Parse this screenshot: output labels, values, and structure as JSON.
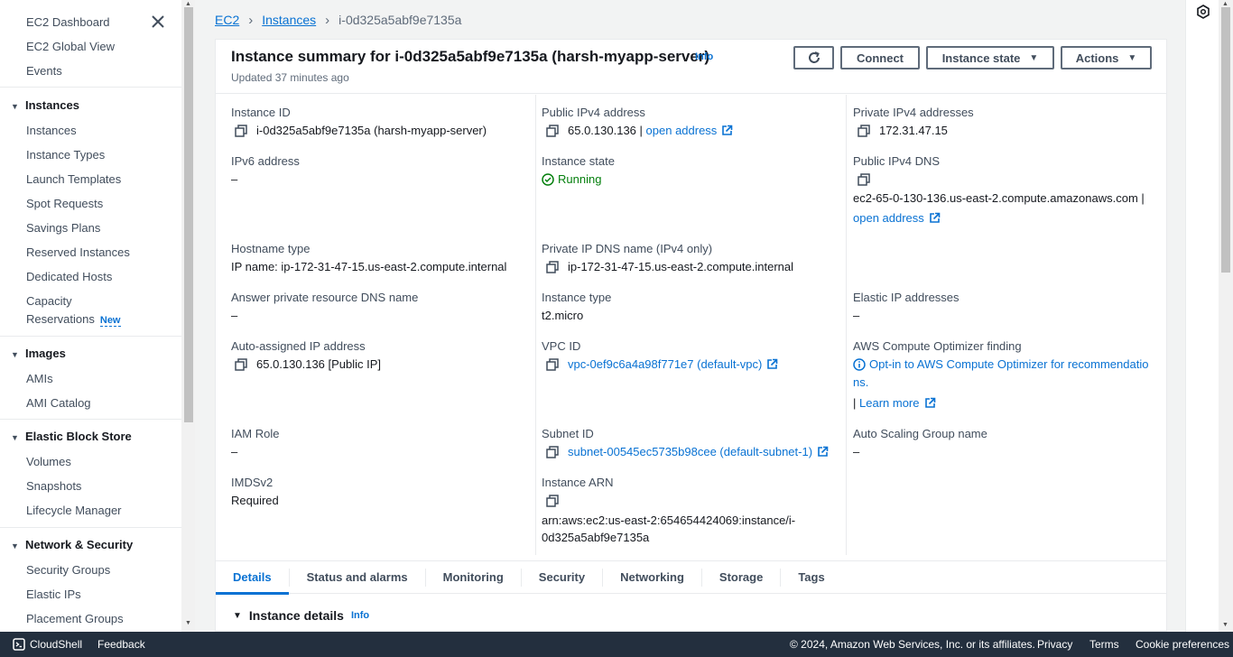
{
  "sidebar": {
    "top": [
      "EC2 Dashboard",
      "EC2 Global View",
      "Events"
    ],
    "sections": [
      {
        "title": "Instances",
        "items": [
          "Instances",
          "Instance Types",
          "Launch Templates",
          "Spot Requests",
          "Savings Plans",
          "Reserved Instances",
          "Dedicated Hosts",
          "Capacity",
          "Reservations"
        ]
      },
      {
        "title": "Images",
        "items": [
          "AMIs",
          "AMI Catalog"
        ]
      },
      {
        "title": "Elastic Block Store",
        "items": [
          "Volumes",
          "Snapshots",
          "Lifecycle Manager"
        ]
      },
      {
        "title": "Network & Security",
        "items": [
          "Security Groups",
          "Elastic IPs",
          "Placement Groups"
        ]
      }
    ],
    "new_badge": "New"
  },
  "breadcrumb": {
    "items": [
      "EC2",
      "Instances"
    ],
    "current": "i-0d325a5abf9e7135a"
  },
  "summary": {
    "title": "Instance summary for i-0d325a5abf9e7135a (harsh-myapp-server)",
    "info": "Info",
    "updated": "Updated 37 minutes ago",
    "buttons": {
      "connect": "Connect",
      "instance_state": "Instance state",
      "actions": "Actions"
    }
  },
  "fields": {
    "instance_id": {
      "label": "Instance ID",
      "value": "i-0d325a5abf9e7135a (harsh-myapp-server)"
    },
    "public_ipv4": {
      "label": "Public IPv4 address",
      "value": "65.0.130.136 |",
      "link": "open address"
    },
    "private_ipv4": {
      "label": "Private IPv4 addresses",
      "value": "172.31.47.15"
    },
    "ipv6": {
      "label": "IPv6 address",
      "value": "–"
    },
    "instance_state": {
      "label": "Instance state",
      "value": "Running"
    },
    "public_dns": {
      "label": "Public IPv4 DNS",
      "value": "ec2-65-0-130-136.us-east-2.compute.amazonaws.com |",
      "link": "open address"
    },
    "hostname_type": {
      "label": "Hostname type",
      "value": "IP name: ip-172-31-47-15.us-east-2.compute.internal"
    },
    "private_dns": {
      "label": "Private IP DNS name (IPv4 only)",
      "value": "ip-172-31-47-15.us-east-2.compute.internal"
    },
    "answer_dns": {
      "label": "Answer private resource DNS name",
      "value": "–"
    },
    "instance_type": {
      "label": "Instance type",
      "value": "t2.micro"
    },
    "elastic_ip": {
      "label": "Elastic IP addresses",
      "value": "–"
    },
    "auto_ip": {
      "label": "Auto-assigned IP address",
      "value": "65.0.130.136 [Public IP]"
    },
    "vpc_id": {
      "label": "VPC ID",
      "value": "vpc-0ef9c6a4a98f771e7 (default-vpc)"
    },
    "optimizer": {
      "label": "AWS Compute Optimizer finding",
      "line1": "Opt-in to AWS Compute Optimizer for recommendatio",
      "line2": "ns.",
      "sep": "|",
      "learn": "Learn more"
    },
    "iam_role": {
      "label": "IAM Role",
      "value": "–"
    },
    "subnet_id": {
      "label": "Subnet ID",
      "value": "subnet-00545ec5735b98cee (default-subnet-1)"
    },
    "asg_name": {
      "label": "Auto Scaling Group name",
      "value": "–"
    },
    "imdsv2": {
      "label": "IMDSv2",
      "value": "Required"
    },
    "arn": {
      "label": "Instance ARN",
      "line1": "arn:aws:ec2:us-east-2:654654424069:instance/i-",
      "line2": "0d325a5abf9e7135a"
    }
  },
  "tabs": [
    "Details",
    "Status and alarms",
    "Monitoring",
    "Security",
    "Networking",
    "Storage",
    "Tags"
  ],
  "details_section": {
    "title": "Instance details",
    "info": "Info"
  },
  "footer": {
    "cloudshell": "CloudShell",
    "feedback": "Feedback",
    "copyright": "© 2024, Amazon Web Services, Inc. or its affiliates.",
    "privacy": "Privacy",
    "terms": "Terms",
    "cookies": "Cookie preferences"
  },
  "colors": {
    "link": "#0972d3",
    "running": "#037f0c",
    "footer_bg": "#232f3e",
    "text": "#16191f"
  }
}
